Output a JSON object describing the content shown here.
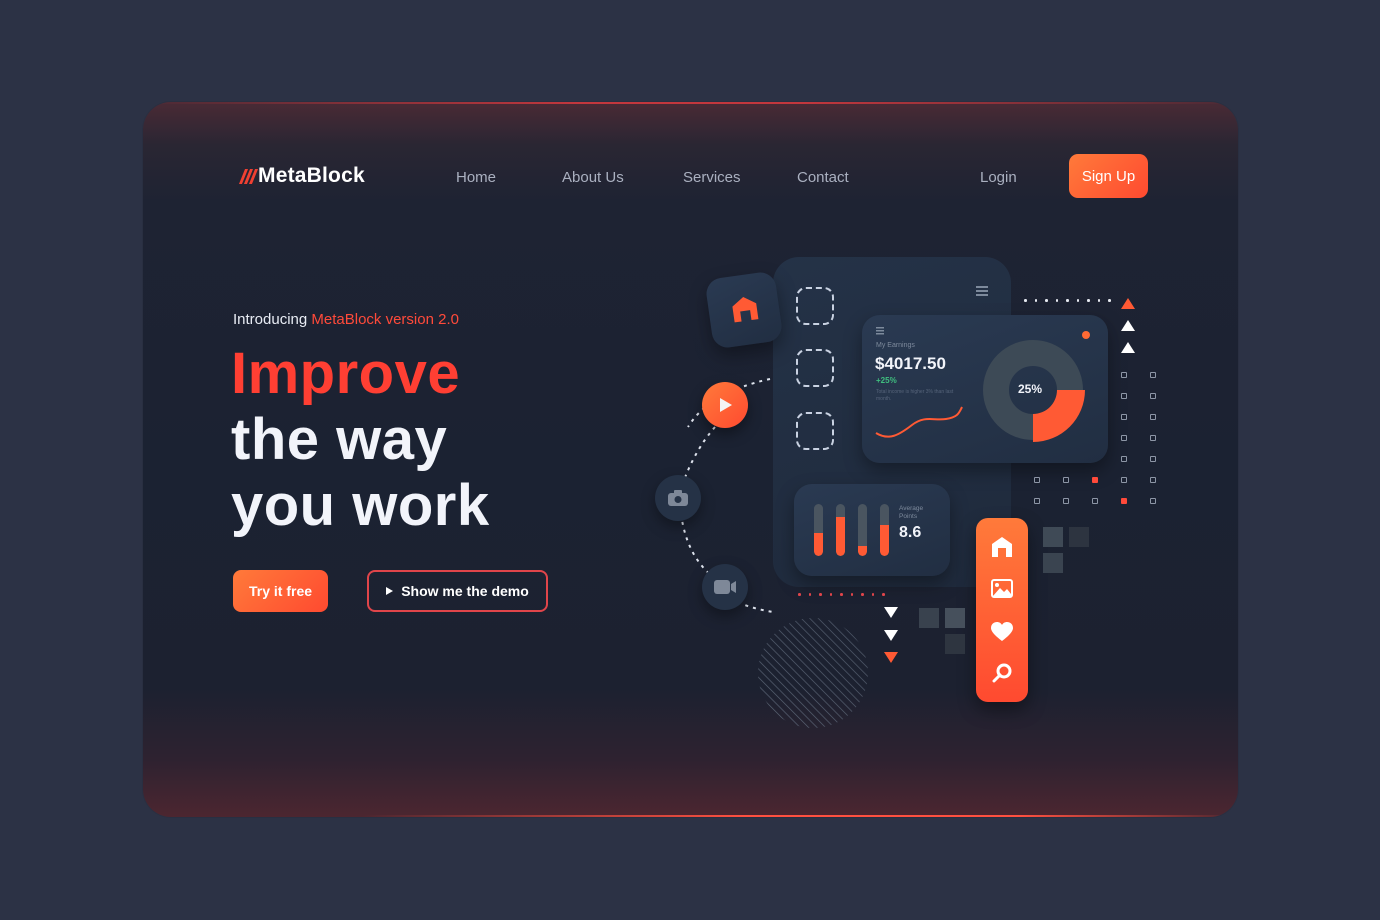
{
  "brand": {
    "name": "MetaBlock",
    "accent": "#ff4a30"
  },
  "nav": {
    "items": [
      {
        "label": "Home"
      },
      {
        "label": "About Us"
      },
      {
        "label": "Services"
      },
      {
        "label": "Contact"
      }
    ],
    "login": "Login",
    "signup": "Sign Up"
  },
  "hero": {
    "intro_prefix": "Introducing",
    "intro_highlight": "MetaBlock version 2.0",
    "headline_line1": "Improve",
    "headline_line2": "the way",
    "headline_line3": "you work",
    "cta_primary": "Try it free",
    "cta_secondary": "Show me the demo"
  },
  "earnings_card": {
    "title": "My Earnings",
    "amount": "$4017.50",
    "change": "+25%",
    "note": "Total income is higher 3% than last month.",
    "donut_label": "25%",
    "donut_percent": 25
  },
  "points_card": {
    "label_line1": "Average",
    "label_line2": "Points",
    "value": "8.6",
    "bars": [
      0.45,
      0.75,
      0.2,
      0.6
    ]
  },
  "icons": {
    "orbit": [
      "play-icon",
      "camera-icon",
      "video-icon"
    ],
    "sidebar": [
      "home-icon",
      "image-icon",
      "heart-icon",
      "search-icon"
    ]
  }
}
